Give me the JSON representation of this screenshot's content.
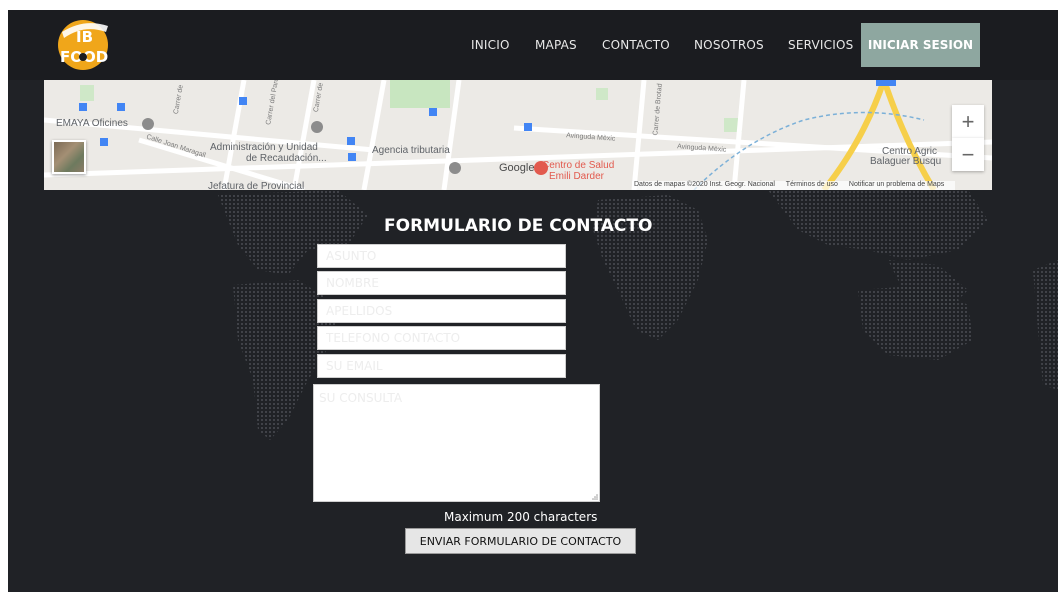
{
  "logo": {
    "text_top": "IB",
    "text_bottom": "FOOD",
    "icon": "ib-food-logo"
  },
  "nav": {
    "items": [
      {
        "label": "INICIO"
      },
      {
        "label": "MAPAS"
      },
      {
        "label": "CONTACTO"
      },
      {
        "label": "NOSOTROS"
      },
      {
        "label": "SERVICIOS"
      }
    ],
    "login_label": "INICIAR SESION"
  },
  "map": {
    "places": {
      "emaya": "EMAYA Oficines",
      "admin_1": "Administración y Unidad",
      "admin_2": "de Recaudación...",
      "agencia": "Agencia tributaria",
      "salud_1": "Centro de Salud",
      "salud_2": "Emili Darder",
      "agric_1": "Centro Agric",
      "agric_2": "Balaguer Busqu",
      "jefatura": "Jefatura de Provincial",
      "google": "Google"
    },
    "streets": {
      "joan_maragall": "Calle Joan Maragall",
      "av_mexic_1": "Avinguda Mèxic",
      "av_mexic_2": "Avinguda Mèxic",
      "carrer_1": "Carrer de",
      "carrer_2": "Carrer del Parc",
      "carrer_3": "Carrer de Brotad",
      "carrer_4": "Carrer de"
    },
    "zoom_in": "+",
    "zoom_out": "−",
    "attribution": {
      "data": "Datos de mapas ©2020 Inst. Geogr. Nacional",
      "terms": "Términos de uso",
      "report": "Notificar un problema de Maps"
    }
  },
  "form": {
    "title": "FORMULARIO DE CONTACTO",
    "fields": {
      "asunto": "ASUNTO",
      "nombre": "NOMBRE",
      "apellidos": "APELLIDOS",
      "telefono": "TELEFONO CONTACTO",
      "email": "SU EMAIL",
      "consulta": "SU CONSULTA"
    },
    "hint": "Maximum 200 characters",
    "submit_label": "ENVIAR FORMULARIO DE CONTACTO"
  },
  "colors": {
    "background": "#202226",
    "header": "#1b1c20",
    "login_button": "#8ea7a0",
    "logo_gold": "#f0a61a"
  }
}
